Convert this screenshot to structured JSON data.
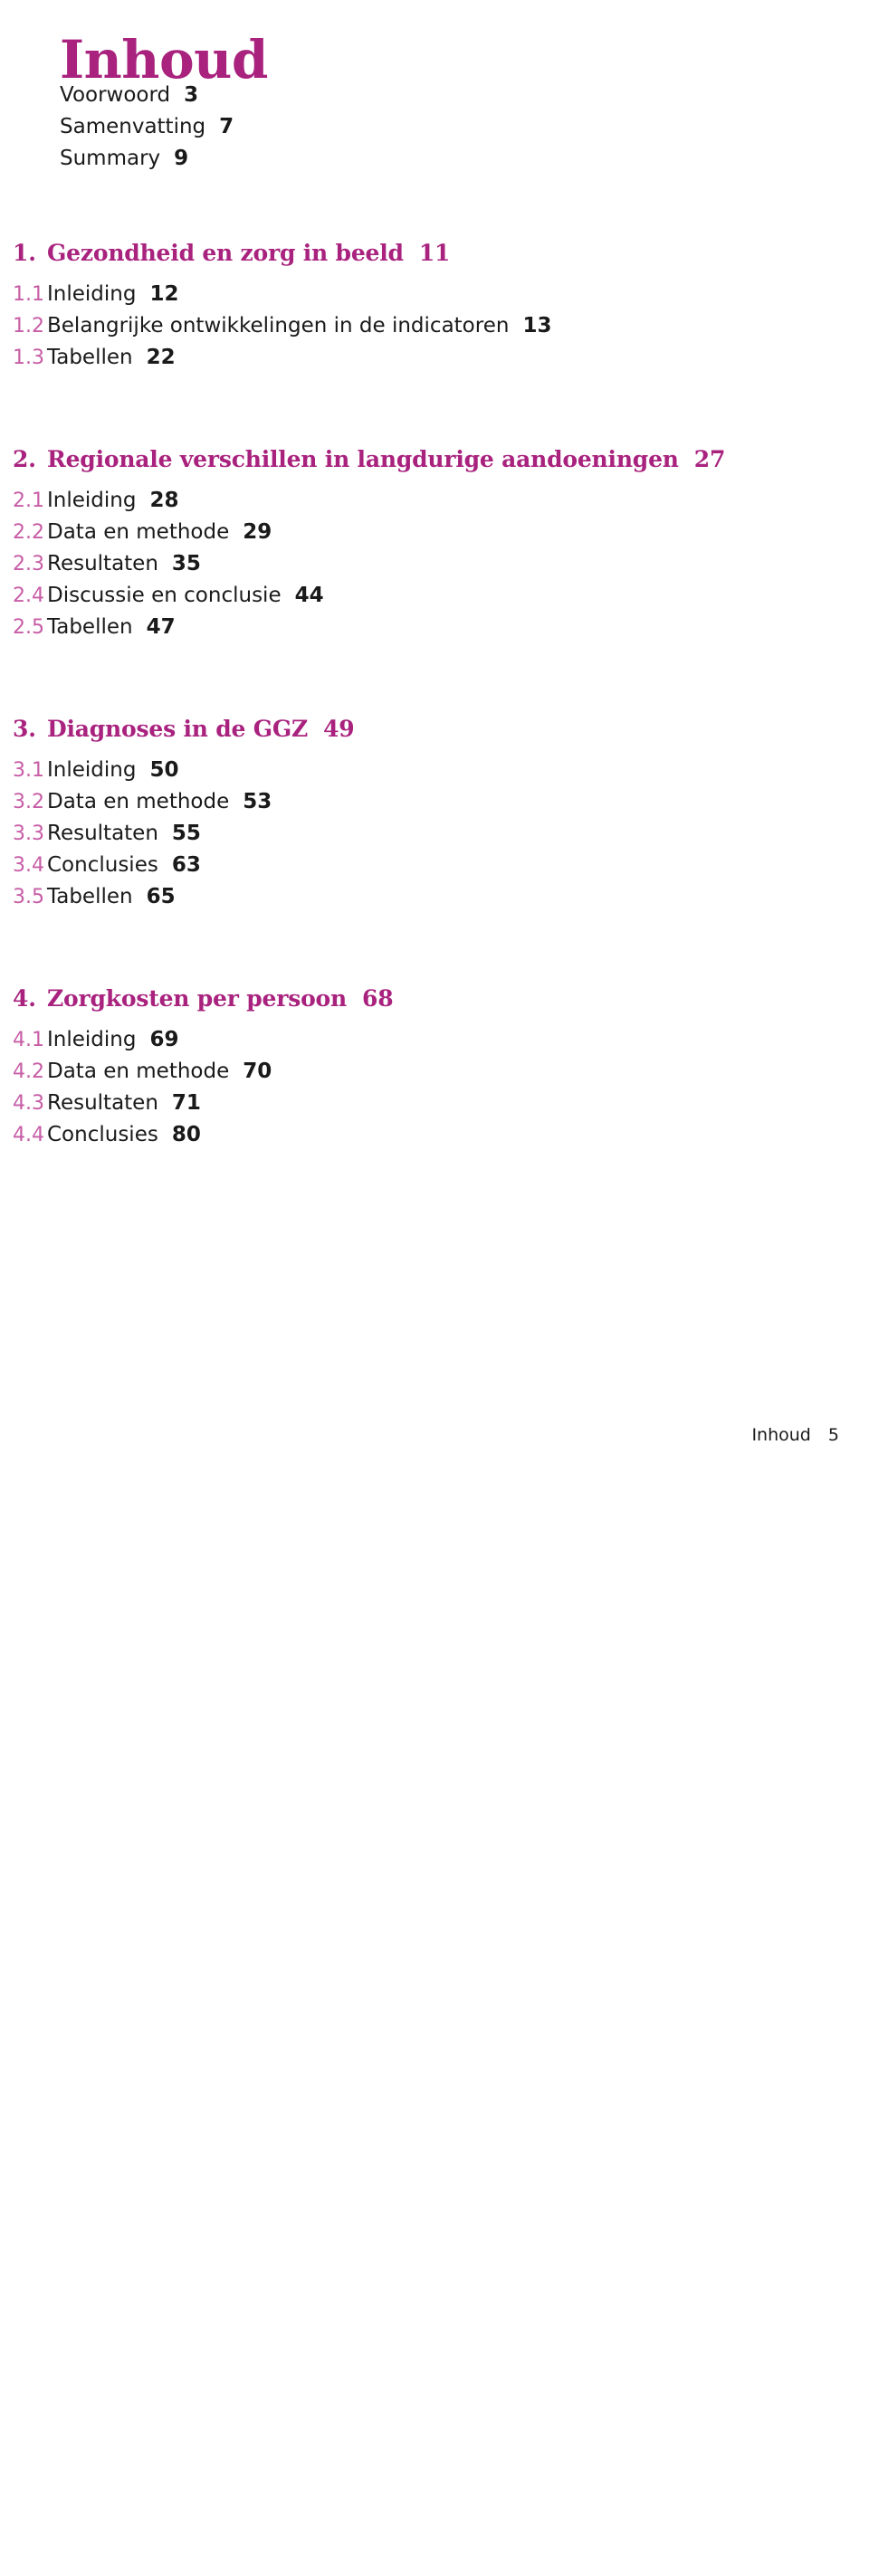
{
  "document": {
    "title": "Inhoud",
    "accent_color": "#a8227e",
    "subnumber_color": "#c75da6",
    "text_color": "#1a1a1a",
    "background_color": "#ffffff"
  },
  "front_matter": [
    {
      "label": "Voorwoord",
      "page": "3"
    },
    {
      "label": "Samenvatting",
      "page": "7"
    },
    {
      "label": "Summary",
      "page": "9"
    }
  ],
  "chapters": [
    {
      "number": "1.",
      "title": "Gezondheid en zorg in beeld",
      "page": "11",
      "sections": [
        {
          "number": "1.1",
          "label": "Inleiding",
          "page": "12"
        },
        {
          "number": "1.2",
          "label": "Belangrijke ontwikkelingen in de indicatoren",
          "page": "13"
        },
        {
          "number": "1.3",
          "label": "Tabellen",
          "page": "22"
        }
      ]
    },
    {
      "number": "2.",
      "title": "Regionale verschillen in langdurige aandoeningen",
      "page": "27",
      "sections": [
        {
          "number": "2.1",
          "label": "Inleiding",
          "page": "28"
        },
        {
          "number": "2.2",
          "label": "Data en methode",
          "page": "29"
        },
        {
          "number": "2.3",
          "label": "Resultaten",
          "page": "35"
        },
        {
          "number": "2.4",
          "label": "Discussie en conclusie",
          "page": "44"
        },
        {
          "number": "2.5",
          "label": "Tabellen",
          "page": "47"
        }
      ]
    },
    {
      "number": "3.",
      "title": "Diagnoses in de GGZ",
      "page": "49",
      "sections": [
        {
          "number": "3.1",
          "label": "Inleiding",
          "page": "50"
        },
        {
          "number": "3.2",
          "label": "Data en methode",
          "page": "53"
        },
        {
          "number": "3.3",
          "label": "Resultaten",
          "page": "55"
        },
        {
          "number": "3.4",
          "label": "Conclusies",
          "page": "63"
        },
        {
          "number": "3.5",
          "label": "Tabellen",
          "page": "65"
        }
      ]
    },
    {
      "number": "4.",
      "title": "Zorgkosten per persoon",
      "page": "68",
      "sections": [
        {
          "number": "4.1",
          "label": "Inleiding",
          "page": "69"
        },
        {
          "number": "4.2",
          "label": "Data en methode",
          "page": "70"
        },
        {
          "number": "4.3",
          "label": "Resultaten",
          "page": "71"
        },
        {
          "number": "4.4",
          "label": "Conclusies",
          "page": "80"
        }
      ]
    }
  ],
  "footer": {
    "label": "Inhoud",
    "page": "5"
  }
}
